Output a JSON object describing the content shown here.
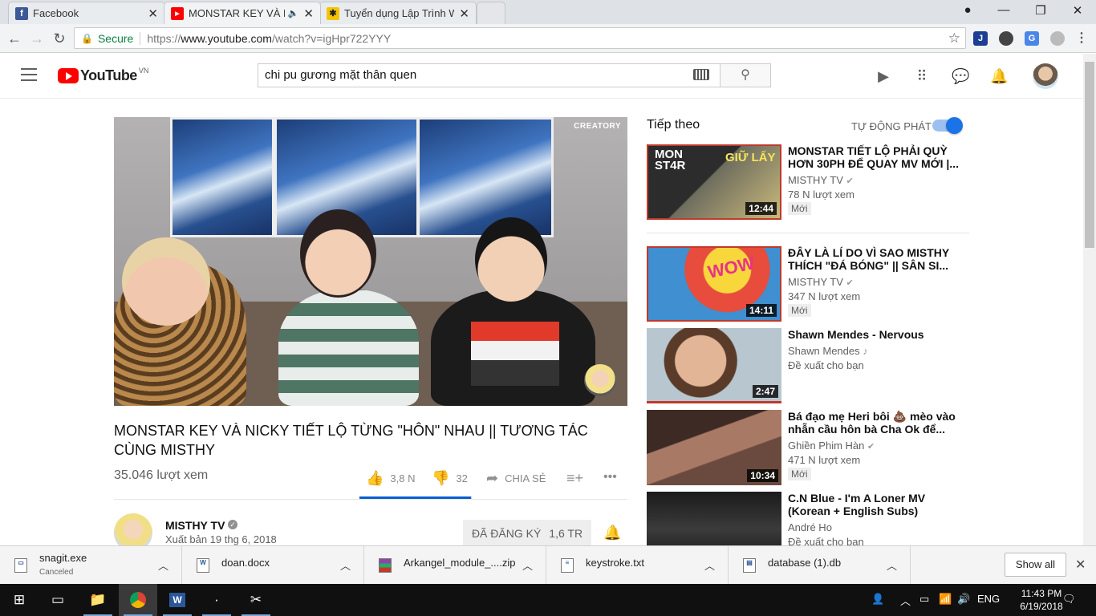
{
  "browser": {
    "tabs": [
      {
        "title": "Facebook",
        "favicon": "facebook-icon",
        "color": "#3b5998"
      },
      {
        "title": "MONSTAR KEY VÀ NI",
        "favicon": "youtube-icon",
        "color": "#ff0000",
        "active": true
      },
      {
        "title": "Tuyển dụng Lập Trình W",
        "favicon": "yellow-logo-icon",
        "color": "#f5c400"
      }
    ],
    "security_label": "Secure",
    "url_prefix": "https://",
    "url_host": "www.youtube.com",
    "url_path": "/watch?v=igHpr722YYY",
    "extension_icon_j": "J"
  },
  "youtube": {
    "logo_text": "YouTube",
    "logo_region": "VN",
    "search_query": "chi pu gương mặt thân quen",
    "video": {
      "watermark": "CREATORY",
      "title": "MONSTAR KEY VÀ NICKY TIẾT LỘ TỪNG \"HÔN\" NHAU || TƯƠNG TÁC CÙNG MISTHY",
      "views": "35.046 lượt xem",
      "likes": "3,8 N",
      "dislikes": "32",
      "share_label": "CHIA SẺ",
      "like_ratio": 0.99
    },
    "channel": {
      "name": "MISTHY TV",
      "published": "Xuất bản 19 thg 6, 2018",
      "subscribe_label": "ĐÃ ĐĂNG KÝ",
      "subscriber_count": "1,6 TR"
    },
    "up_next": {
      "label": "Tiếp theo",
      "autoplay_label": "TỰ ĐỘNG PHÁT",
      "autoplay_on": true,
      "items": [
        {
          "title": "MONSTAR TIẾT LỘ PHẢI QUỲ HƠN 30PH ĐỂ QUAY MV MỚI |...",
          "channel": "MISTHY TV",
          "verified": true,
          "views": "78 N lượt xem",
          "badge": "Mới",
          "duration": "12:44"
        },
        {
          "title": "ĐÂY LÀ LÍ DO VÌ SAO MISTHY THÍCH \"ĐÁ BÓNG\" || SÂN SI...",
          "channel": "MISTHY TV",
          "verified": true,
          "views": "347 N lượt xem",
          "badge": "Mới",
          "duration": "14:11"
        },
        {
          "title": "Shawn Mendes - Nervous",
          "channel": "Shawn Mendes",
          "music_note": "♪",
          "views": "Đề xuất cho bạn",
          "badge": "",
          "duration": "2:47"
        },
        {
          "title": "Bá đạo mẹ Heri bôi 💩 mèo vào nhẫn cầu hôn bà Cha Ok để...",
          "channel": "Ghiền Phim Hàn",
          "verified": true,
          "views": "471 N lượt xem",
          "badge": "Mới",
          "duration": "10:34"
        },
        {
          "title": "C.N Blue - I'm A Loner MV (Korean + English Subs)",
          "channel": "André Ho",
          "views": "Đề xuất cho bạn",
          "badge": "",
          "duration": ""
        }
      ]
    }
  },
  "downloads": {
    "items": [
      {
        "name": "snagit.exe",
        "status": "Canceled",
        "icon": "exe-file-icon"
      },
      {
        "name": "doan.docx",
        "status": "",
        "icon": "word-file-icon"
      },
      {
        "name": "Arkangel_module_....zip",
        "status": "",
        "icon": "zip-file-icon"
      },
      {
        "name": "keystroke.txt",
        "status": "",
        "icon": "text-file-icon"
      },
      {
        "name": "database (1).db",
        "status": "",
        "icon": "db-file-icon"
      }
    ],
    "show_all_label": "Show all"
  },
  "taskbar": {
    "language": "ENG",
    "time": "11:43 PM",
    "date": "6/19/2018"
  }
}
